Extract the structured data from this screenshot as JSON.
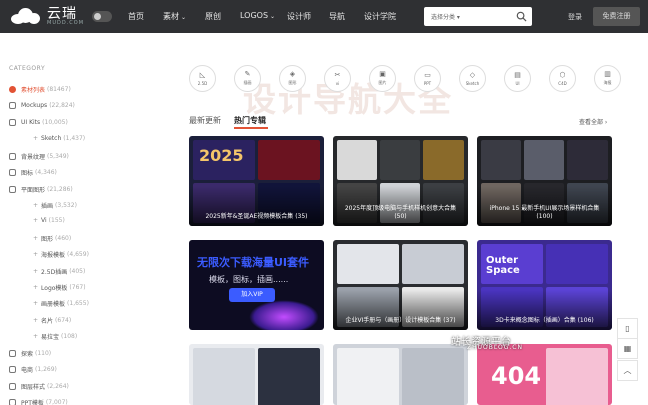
{
  "header": {
    "logo_main": "云瑞",
    "logo_sub": "MUDD.COM",
    "nav": [
      {
        "label": "首页",
        "dropdown": false
      },
      {
        "label": "素材",
        "dropdown": true
      },
      {
        "label": "原创",
        "dropdown": false
      },
      {
        "label": "LOGOS",
        "dropdown": true
      },
      {
        "label": "设计师",
        "dropdown": false
      },
      {
        "label": "导航",
        "dropdown": false
      },
      {
        "label": "设计学院",
        "dropdown": false
      }
    ],
    "search_select": "选择分类 ▾",
    "login": "登录",
    "register": "免费注册"
  },
  "sidebar": {
    "title": "CATEGORY",
    "items": [
      {
        "label": "素材列表",
        "count": "(81467)",
        "level": 0,
        "active": true
      },
      {
        "label": "Mockups",
        "count": "(22,824)",
        "level": 0,
        "active": false
      },
      {
        "label": "UI Kits",
        "count": "(10,005)",
        "level": 0,
        "active": false
      },
      {
        "label": "Sketch",
        "count": "(1,437)",
        "level": 1,
        "active": false
      },
      {
        "label": "背景纹理",
        "count": "(5,349)",
        "level": 0,
        "active": false
      },
      {
        "label": "图标",
        "count": "(4,346)",
        "level": 0,
        "active": false
      },
      {
        "label": "平面图形",
        "count": "(21,286)",
        "level": 0,
        "active": false
      },
      {
        "label": "插画",
        "count": "(3,532)",
        "level": 1,
        "active": false
      },
      {
        "label": "Vi",
        "count": "(155)",
        "level": 1,
        "active": false
      },
      {
        "label": "图形",
        "count": "(460)",
        "level": 1,
        "active": false
      },
      {
        "label": "海报模板",
        "count": "(4,659)",
        "level": 1,
        "active": false
      },
      {
        "label": "2.5D插画",
        "count": "(405)",
        "level": 1,
        "active": false
      },
      {
        "label": "Logo模板",
        "count": "(767)",
        "level": 1,
        "active": false
      },
      {
        "label": "画册模板",
        "count": "(1,655)",
        "level": 1,
        "active": false
      },
      {
        "label": "名片",
        "count": "(674)",
        "level": 1,
        "active": false
      },
      {
        "label": "易拉宝",
        "count": "(108)",
        "level": 1,
        "active": false
      },
      {
        "label": "探索",
        "count": "(110)",
        "level": 0,
        "active": false
      },
      {
        "label": "电商",
        "count": "(1,269)",
        "level": 0,
        "active": false
      },
      {
        "label": "图层样式",
        "count": "(2,264)",
        "level": 0,
        "active": false
      },
      {
        "label": "PPT模板",
        "count": "(7,007)",
        "level": 0,
        "active": false
      }
    ]
  },
  "categories": [
    {
      "label": "2.5D",
      "glyph": "◺",
      "icon": "isometric-icon"
    },
    {
      "label": "插画",
      "glyph": "✎",
      "icon": "brush-icon"
    },
    {
      "label": "图形",
      "glyph": "◈",
      "icon": "shapes-icon"
    },
    {
      "label": "vi",
      "glyph": "✂",
      "icon": "vi-icon"
    },
    {
      "label": "图片",
      "glyph": "▣",
      "icon": "photo-icon"
    },
    {
      "label": "PPT",
      "glyph": "▭",
      "icon": "ppt-icon"
    },
    {
      "label": "Sketch",
      "glyph": "◇",
      "icon": "sketch-icon"
    },
    {
      "label": "UI",
      "glyph": "▤",
      "icon": "ui-icon"
    },
    {
      "label": "C4D",
      "glyph": "⬡",
      "icon": "c4d-icon"
    },
    {
      "label": "海报",
      "glyph": "▥",
      "icon": "poster-icon"
    }
  ],
  "main": {
    "watermark": "设计导航大全",
    "tab_latest": "最新更新",
    "tab_hot": "热门专辑",
    "view_all": "查看全部 ›",
    "cards": [
      {
        "caption": "2025新年&圣诞AE视频模板合集 (35)"
      },
      {
        "caption": "2025年度顶级电脑与手机样机创意大合集 (50)"
      },
      {
        "caption": "iPhone 15 最新手机UI展示场景样机合集 (100)"
      },
      {
        "caption": ""
      },
      {
        "caption": "企业VI手册与（画册）设计模板合集 (37)"
      },
      {
        "caption": "3D卡来概念图标（插画）合集 (106)"
      },
      {
        "caption": ""
      },
      {
        "caption": ""
      },
      {
        "caption": ""
      }
    ],
    "promo_title": "无限次下载海量UI套件",
    "promo_sub": "模板，图标，插画......",
    "promo_btn": "加入VIP",
    "site_watermark_cn": "站长资源平台",
    "site_watermark": "ZHUOBLOG.CN"
  },
  "floating": [
    {
      "glyph": "▯",
      "icon": "mobile-icon"
    },
    {
      "glyph": "▦",
      "icon": "qrcode-icon"
    },
    {
      "glyph": "︿",
      "icon": "back-to-top-icon"
    }
  ]
}
